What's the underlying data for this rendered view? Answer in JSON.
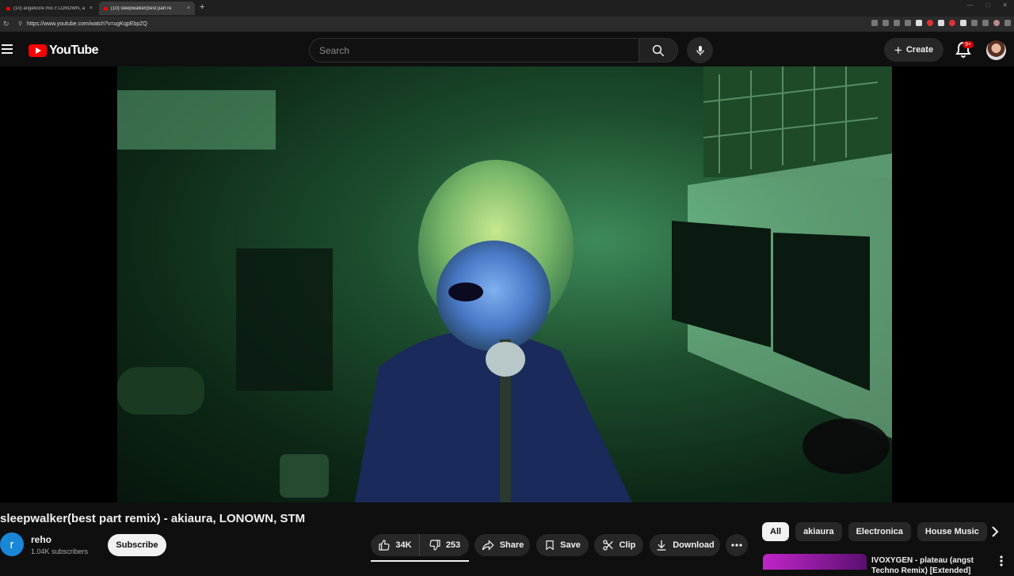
{
  "browser": {
    "tabs": [
      {
        "title": "(10) angelcore mix // LONOWN, a"
      },
      {
        "title": "(10) sleepwalker(best part re"
      }
    ],
    "new_tab": "+",
    "close": "×",
    "url": "https://www.youtube.com/watch?v=ugKqpEbpZQ"
  },
  "masthead": {
    "logo_text": "YouTube",
    "search_placeholder": "Search",
    "create_label": "Create",
    "notifications_badge": "9+"
  },
  "video": {
    "title": "sleepwalker(best part remix) - akiaura, LONOWN, STM",
    "channel": {
      "avatar_letter": "r",
      "name": "reho",
      "subscribers": "1.04K subscribers",
      "subscribe_label": "Subscribe"
    },
    "actions": {
      "likes": "34K",
      "dislikes": "253",
      "share": "Share",
      "save": "Save",
      "clip": "Clip",
      "download": "Download"
    }
  },
  "sidebar": {
    "chips": [
      "All",
      "akiaura",
      "Electronica",
      "House Music"
    ],
    "recommendation": {
      "title": "IVOXYGEN - plateau (angst Techno Remix) [Extended]"
    }
  },
  "colors": {
    "brand_red": "#ff0000",
    "background": "#0f0f0f",
    "surface": "#272727",
    "channel_avatar": "#1a86d8"
  }
}
